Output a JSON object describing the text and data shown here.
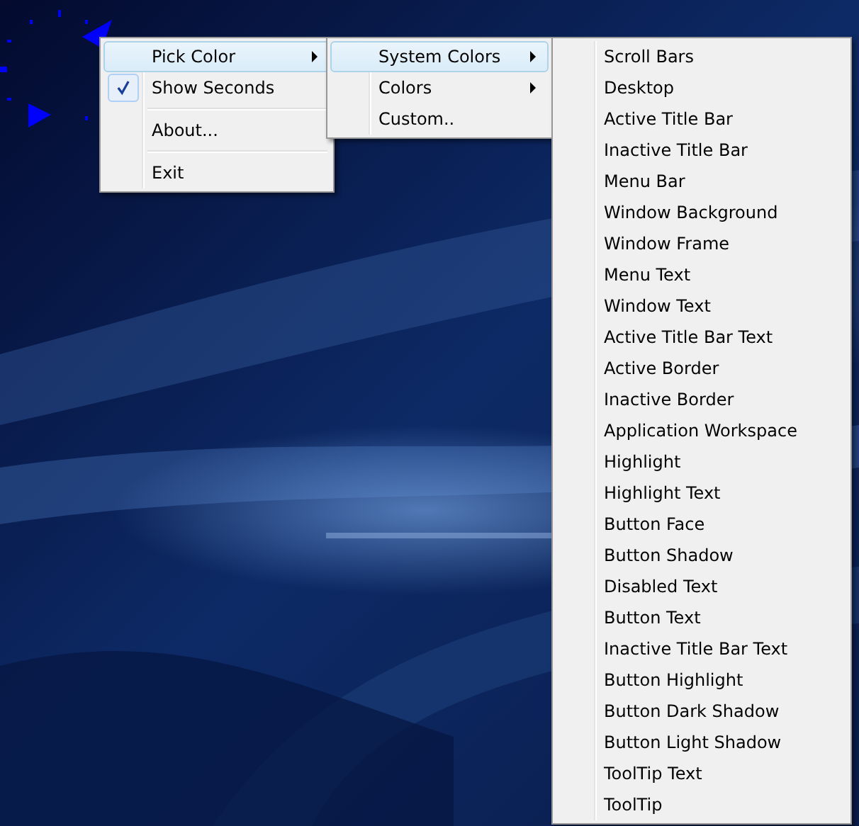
{
  "menus": [
    {
      "items": [
        {
          "kind": "item",
          "label": "Pick Color",
          "highlighted": true,
          "checked": false,
          "submenu": true
        },
        {
          "kind": "item",
          "label": "Show Seconds",
          "highlighted": false,
          "checked": true,
          "submenu": false
        },
        {
          "kind": "separator"
        },
        {
          "kind": "item",
          "label": "About...",
          "highlighted": false,
          "checked": false,
          "submenu": false
        },
        {
          "kind": "separator"
        },
        {
          "kind": "item",
          "label": "Exit",
          "highlighted": false,
          "checked": false,
          "submenu": false
        }
      ]
    },
    {
      "items": [
        {
          "kind": "item",
          "label": "System Colors",
          "highlighted": true,
          "checked": false,
          "submenu": true
        },
        {
          "kind": "item",
          "label": "Colors",
          "highlighted": false,
          "checked": false,
          "submenu": true
        },
        {
          "kind": "item",
          "label": "Custom..",
          "highlighted": false,
          "checked": false,
          "submenu": false
        }
      ]
    },
    {
      "items": [
        {
          "kind": "item",
          "label": "Scroll Bars",
          "highlighted": false,
          "checked": false,
          "submenu": false
        },
        {
          "kind": "item",
          "label": "Desktop",
          "highlighted": false,
          "checked": false,
          "submenu": false
        },
        {
          "kind": "item",
          "label": "Active Title Bar",
          "highlighted": false,
          "checked": false,
          "submenu": false
        },
        {
          "kind": "item",
          "label": "Inactive Title Bar",
          "highlighted": false,
          "checked": false,
          "submenu": false
        },
        {
          "kind": "item",
          "label": "Menu Bar",
          "highlighted": false,
          "checked": false,
          "submenu": false
        },
        {
          "kind": "item",
          "label": "Window Background",
          "highlighted": false,
          "checked": false,
          "submenu": false
        },
        {
          "kind": "item",
          "label": "Window Frame",
          "highlighted": false,
          "checked": false,
          "submenu": false
        },
        {
          "kind": "item",
          "label": "Menu Text",
          "highlighted": false,
          "checked": false,
          "submenu": false
        },
        {
          "kind": "item",
          "label": "Window Text",
          "highlighted": false,
          "checked": false,
          "submenu": false
        },
        {
          "kind": "item",
          "label": "Active Title Bar Text",
          "highlighted": false,
          "checked": false,
          "submenu": false
        },
        {
          "kind": "item",
          "label": "Active Border",
          "highlighted": false,
          "checked": false,
          "submenu": false
        },
        {
          "kind": "item",
          "label": "Inactive Border",
          "highlighted": false,
          "checked": false,
          "submenu": false
        },
        {
          "kind": "item",
          "label": "Application Workspace",
          "highlighted": false,
          "checked": false,
          "submenu": false
        },
        {
          "kind": "item",
          "label": "Highlight",
          "highlighted": false,
          "checked": false,
          "submenu": false
        },
        {
          "kind": "item",
          "label": "Highlight Text",
          "highlighted": false,
          "checked": false,
          "submenu": false
        },
        {
          "kind": "item",
          "label": "Button Face",
          "highlighted": false,
          "checked": false,
          "submenu": false
        },
        {
          "kind": "item",
          "label": "Button Shadow",
          "highlighted": false,
          "checked": false,
          "submenu": false
        },
        {
          "kind": "item",
          "label": "Disabled Text",
          "highlighted": false,
          "checked": false,
          "submenu": false
        },
        {
          "kind": "item",
          "label": "Button Text",
          "highlighted": false,
          "checked": false,
          "submenu": false
        },
        {
          "kind": "item",
          "label": "Inactive Title Bar Text",
          "highlighted": false,
          "checked": false,
          "submenu": false
        },
        {
          "kind": "item",
          "label": "Button Highlight",
          "highlighted": false,
          "checked": false,
          "submenu": false
        },
        {
          "kind": "item",
          "label": "Button Dark Shadow",
          "highlighted": false,
          "checked": false,
          "submenu": false
        },
        {
          "kind": "item",
          "label": "Button Light Shadow",
          "highlighted": false,
          "checked": false,
          "submenu": false
        },
        {
          "kind": "item",
          "label": "ToolTip Text",
          "highlighted": false,
          "checked": false,
          "submenu": false
        },
        {
          "kind": "item",
          "label": "ToolTip",
          "highlighted": false,
          "checked": false,
          "submenu": false
        }
      ]
    }
  ]
}
